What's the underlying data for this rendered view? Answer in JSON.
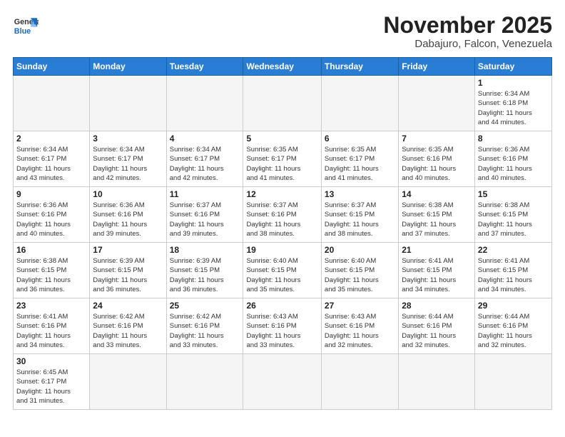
{
  "header": {
    "logo_general": "General",
    "logo_blue": "Blue",
    "month_title": "November 2025",
    "location": "Dabajuro, Falcon, Venezuela"
  },
  "weekdays": [
    "Sunday",
    "Monday",
    "Tuesday",
    "Wednesday",
    "Thursday",
    "Friday",
    "Saturday"
  ],
  "weeks": [
    [
      {
        "day": "",
        "info": ""
      },
      {
        "day": "",
        "info": ""
      },
      {
        "day": "",
        "info": ""
      },
      {
        "day": "",
        "info": ""
      },
      {
        "day": "",
        "info": ""
      },
      {
        "day": "",
        "info": ""
      },
      {
        "day": "1",
        "info": "Sunrise: 6:34 AM\nSunset: 6:18 PM\nDaylight: 11 hours\nand 44 minutes."
      }
    ],
    [
      {
        "day": "2",
        "info": "Sunrise: 6:34 AM\nSunset: 6:17 PM\nDaylight: 11 hours\nand 43 minutes."
      },
      {
        "day": "3",
        "info": "Sunrise: 6:34 AM\nSunset: 6:17 PM\nDaylight: 11 hours\nand 42 minutes."
      },
      {
        "day": "4",
        "info": "Sunrise: 6:34 AM\nSunset: 6:17 PM\nDaylight: 11 hours\nand 42 minutes."
      },
      {
        "day": "5",
        "info": "Sunrise: 6:35 AM\nSunset: 6:17 PM\nDaylight: 11 hours\nand 41 minutes."
      },
      {
        "day": "6",
        "info": "Sunrise: 6:35 AM\nSunset: 6:17 PM\nDaylight: 11 hours\nand 41 minutes."
      },
      {
        "day": "7",
        "info": "Sunrise: 6:35 AM\nSunset: 6:16 PM\nDaylight: 11 hours\nand 40 minutes."
      },
      {
        "day": "8",
        "info": "Sunrise: 6:36 AM\nSunset: 6:16 PM\nDaylight: 11 hours\nand 40 minutes."
      }
    ],
    [
      {
        "day": "9",
        "info": "Sunrise: 6:36 AM\nSunset: 6:16 PM\nDaylight: 11 hours\nand 40 minutes."
      },
      {
        "day": "10",
        "info": "Sunrise: 6:36 AM\nSunset: 6:16 PM\nDaylight: 11 hours\nand 39 minutes."
      },
      {
        "day": "11",
        "info": "Sunrise: 6:37 AM\nSunset: 6:16 PM\nDaylight: 11 hours\nand 39 minutes."
      },
      {
        "day": "12",
        "info": "Sunrise: 6:37 AM\nSunset: 6:16 PM\nDaylight: 11 hours\nand 38 minutes."
      },
      {
        "day": "13",
        "info": "Sunrise: 6:37 AM\nSunset: 6:15 PM\nDaylight: 11 hours\nand 38 minutes."
      },
      {
        "day": "14",
        "info": "Sunrise: 6:38 AM\nSunset: 6:15 PM\nDaylight: 11 hours\nand 37 minutes."
      },
      {
        "day": "15",
        "info": "Sunrise: 6:38 AM\nSunset: 6:15 PM\nDaylight: 11 hours\nand 37 minutes."
      }
    ],
    [
      {
        "day": "16",
        "info": "Sunrise: 6:38 AM\nSunset: 6:15 PM\nDaylight: 11 hours\nand 36 minutes."
      },
      {
        "day": "17",
        "info": "Sunrise: 6:39 AM\nSunset: 6:15 PM\nDaylight: 11 hours\nand 36 minutes."
      },
      {
        "day": "18",
        "info": "Sunrise: 6:39 AM\nSunset: 6:15 PM\nDaylight: 11 hours\nand 36 minutes."
      },
      {
        "day": "19",
        "info": "Sunrise: 6:40 AM\nSunset: 6:15 PM\nDaylight: 11 hours\nand 35 minutes."
      },
      {
        "day": "20",
        "info": "Sunrise: 6:40 AM\nSunset: 6:15 PM\nDaylight: 11 hours\nand 35 minutes."
      },
      {
        "day": "21",
        "info": "Sunrise: 6:41 AM\nSunset: 6:15 PM\nDaylight: 11 hours\nand 34 minutes."
      },
      {
        "day": "22",
        "info": "Sunrise: 6:41 AM\nSunset: 6:15 PM\nDaylight: 11 hours\nand 34 minutes."
      }
    ],
    [
      {
        "day": "23",
        "info": "Sunrise: 6:41 AM\nSunset: 6:16 PM\nDaylight: 11 hours\nand 34 minutes."
      },
      {
        "day": "24",
        "info": "Sunrise: 6:42 AM\nSunset: 6:16 PM\nDaylight: 11 hours\nand 33 minutes."
      },
      {
        "day": "25",
        "info": "Sunrise: 6:42 AM\nSunset: 6:16 PM\nDaylight: 11 hours\nand 33 minutes."
      },
      {
        "day": "26",
        "info": "Sunrise: 6:43 AM\nSunset: 6:16 PM\nDaylight: 11 hours\nand 33 minutes."
      },
      {
        "day": "27",
        "info": "Sunrise: 6:43 AM\nSunset: 6:16 PM\nDaylight: 11 hours\nand 32 minutes."
      },
      {
        "day": "28",
        "info": "Sunrise: 6:44 AM\nSunset: 6:16 PM\nDaylight: 11 hours\nand 32 minutes."
      },
      {
        "day": "29",
        "info": "Sunrise: 6:44 AM\nSunset: 6:16 PM\nDaylight: 11 hours\nand 32 minutes."
      }
    ],
    [
      {
        "day": "30",
        "info": "Sunrise: 6:45 AM\nSunset: 6:17 PM\nDaylight: 11 hours\nand 31 minutes."
      },
      {
        "day": "",
        "info": ""
      },
      {
        "day": "",
        "info": ""
      },
      {
        "day": "",
        "info": ""
      },
      {
        "day": "",
        "info": ""
      },
      {
        "day": "",
        "info": ""
      },
      {
        "day": "",
        "info": ""
      }
    ]
  ]
}
